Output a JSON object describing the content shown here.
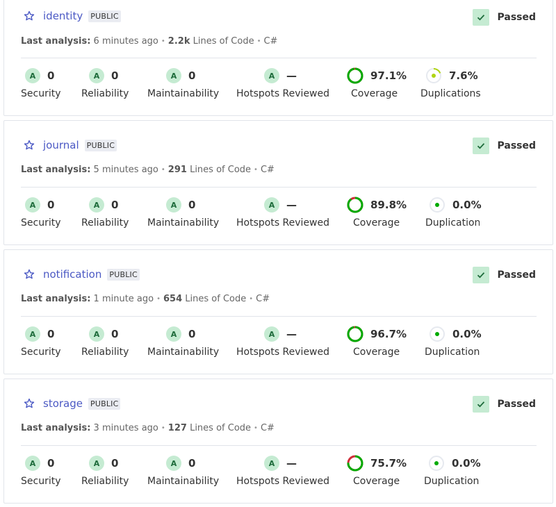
{
  "labels": {
    "last_analysis": "Last analysis:",
    "lines_of_code": "Lines of Code",
    "security": "Security",
    "reliability": "Reliability",
    "maintainability": "Maintainability",
    "hotspots": "Hotspots Reviewed",
    "coverage": "Coverage",
    "duplications": "Duplications",
    "public": "PUBLIC",
    "passed": "Passed"
  },
  "colors": {
    "link": "#4b59c4",
    "grade_bg": "#c5ebd2",
    "coverage_good": "#00aa00",
    "coverage_bad": "#d02f3a",
    "dup_green": "#00aa00",
    "dup_yellow": "#b0d513"
  },
  "projects": [
    {
      "name": "identity",
      "badge": "PUBLIC",
      "gate": "Passed",
      "analysis_time": "6 minutes ago",
      "loc": "2.2k",
      "language": "C#",
      "security": {
        "grade": "A",
        "value": "0"
      },
      "reliability": {
        "grade": "A",
        "value": "0"
      },
      "maintainability": {
        "grade": "A",
        "value": "0"
      },
      "hotspots": {
        "grade": "A",
        "value": "—"
      },
      "coverage": {
        "value": "97.1%",
        "percent": 97.1
      },
      "duplications": {
        "value": "7.6%",
        "percent": 7.6
      }
    },
    {
      "name": "journal",
      "badge": "PUBLIC",
      "gate": "Passed",
      "analysis_time": "5 minutes ago",
      "loc": "291",
      "language": "C#",
      "security": {
        "grade": "A",
        "value": "0"
      },
      "reliability": {
        "grade": "A",
        "value": "0"
      },
      "maintainability": {
        "grade": "A",
        "value": "0"
      },
      "hotspots": {
        "grade": "A",
        "value": "—"
      },
      "coverage": {
        "value": "89.8%",
        "percent": 89.8
      },
      "duplications": {
        "value": "0.0%",
        "percent": 0.0
      }
    },
    {
      "name": "notification",
      "badge": "PUBLIC",
      "gate": "Passed",
      "analysis_time": "1 minute ago",
      "loc": "654",
      "language": "C#",
      "security": {
        "grade": "A",
        "value": "0"
      },
      "reliability": {
        "grade": "A",
        "value": "0"
      },
      "maintainability": {
        "grade": "A",
        "value": "0"
      },
      "hotspots": {
        "grade": "A",
        "value": "—"
      },
      "coverage": {
        "value": "96.7%",
        "percent": 96.7
      },
      "duplications": {
        "value": "0.0%",
        "percent": 0.0
      }
    },
    {
      "name": "storage",
      "badge": "PUBLIC",
      "gate": "Passed",
      "analysis_time": "3 minutes ago",
      "loc": "127",
      "language": "C#",
      "security": {
        "grade": "A",
        "value": "0"
      },
      "reliability": {
        "grade": "A",
        "value": "0"
      },
      "maintainability": {
        "grade": "A",
        "value": "0"
      },
      "hotspots": {
        "grade": "A",
        "value": "—"
      },
      "coverage": {
        "value": "75.7%",
        "percent": 75.7
      },
      "duplications": {
        "value": "0.0%",
        "percent": 0.0
      }
    }
  ]
}
